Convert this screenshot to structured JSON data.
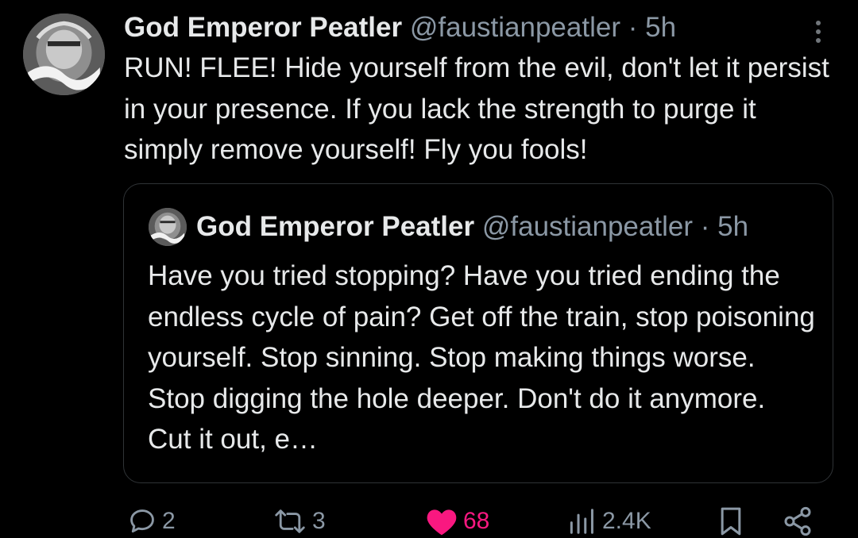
{
  "tweet": {
    "author": {
      "name": "God Emperor Peatler",
      "handle": "@faustianpeatler",
      "separator": "·",
      "time": "5h",
      "avatar_icon": "avatar-icon"
    },
    "text": "RUN! FLEE! Hide yourself from the evil, don't let it persist in your presence. If you lack the strength to purge it simply remove yourself! Fly you fools!",
    "quoted": {
      "author": {
        "name": "God Emperor Peatler",
        "handle": "@faustianpeatler",
        "separator": "·",
        "time": "5h"
      },
      "text": "Have you tried stopping? Have you tried ending the endless cycle of pain? Get off the train, stop poisoning yourself. Stop sinning. Stop making things worse. Stop digging the hole deeper. Don't do it anymore. Cut it out, e…"
    },
    "actions": {
      "replies": "2",
      "reposts": "3",
      "likes": "68",
      "views": "2.4K",
      "liked": true
    }
  },
  "colors": {
    "background": "#000000",
    "text": "#e7e9ea",
    "muted": "#8b98a5",
    "border": "#2f3336",
    "like": "#f91880"
  }
}
